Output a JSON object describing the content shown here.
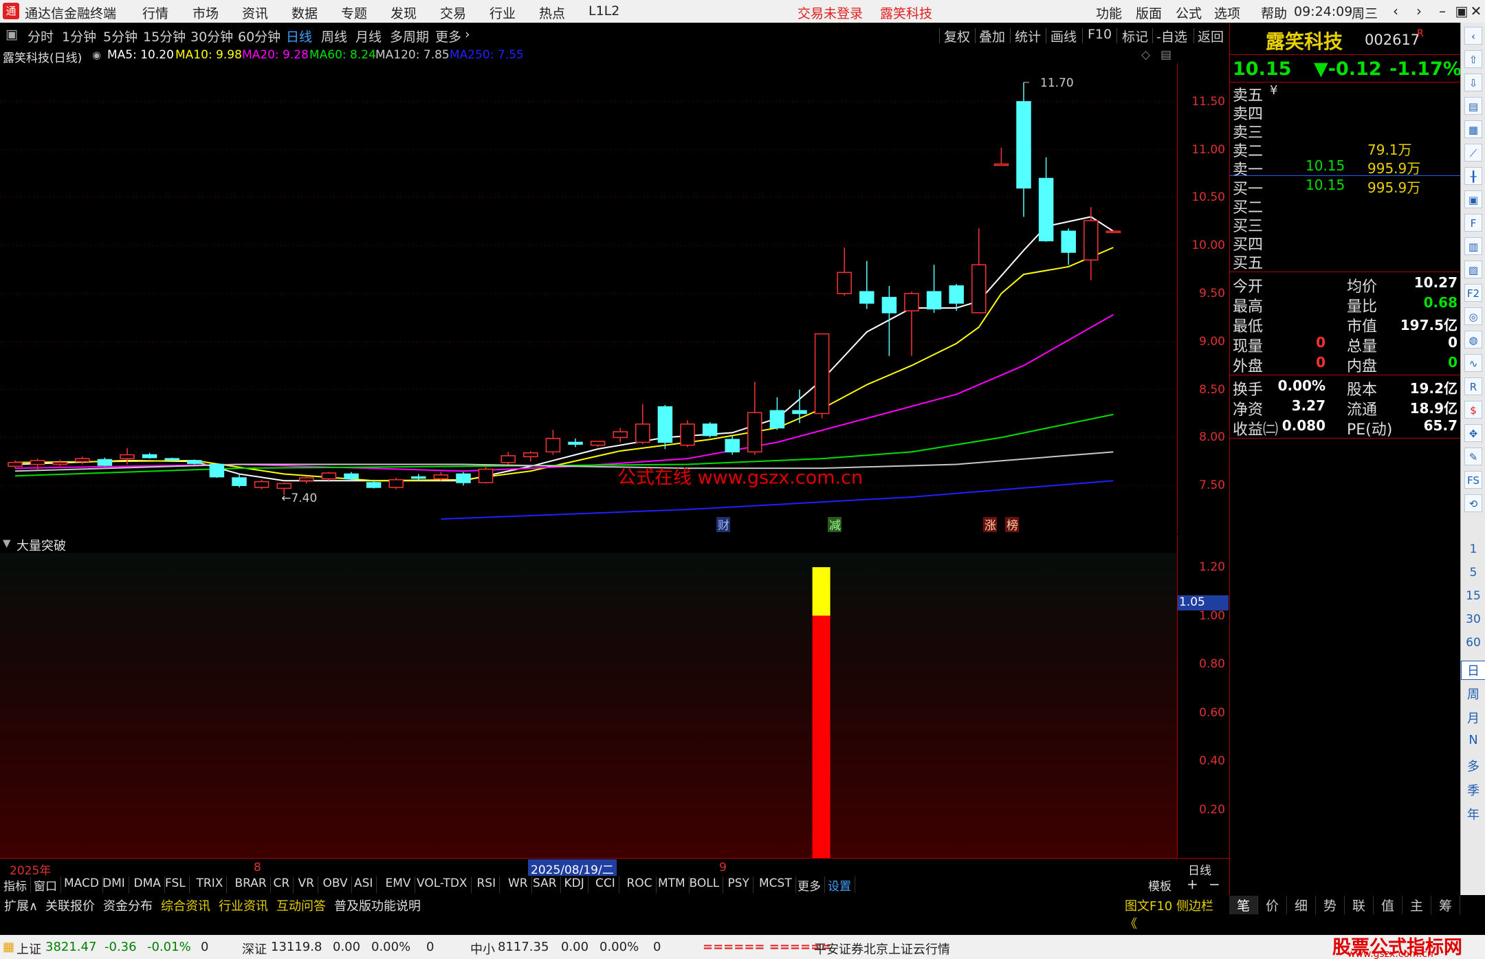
{
  "titlebar": {
    "app_title": "通达信金融终端",
    "menus": [
      "行情",
      "市场",
      "资讯",
      "数据",
      "专题",
      "发现",
      "交易",
      "行业",
      "热点",
      "L1L2"
    ],
    "trade_status": "交易未登录",
    "stock_name": "露笑科技",
    "right_menus": [
      "功能",
      "版面",
      "公式",
      "选项",
      "帮助"
    ],
    "time": "09:24:09",
    "weekday": "周三"
  },
  "periodbar": {
    "periods": [
      "分时",
      "1分钟",
      "5分钟",
      "15分钟",
      "30分钟",
      "60分钟",
      "日线",
      "周线",
      "月线",
      "多周期",
      "更多"
    ],
    "active": "日线",
    "tools": [
      "复权",
      "叠加",
      "统计",
      "画线",
      "F10",
      "标记",
      "-自选",
      "返回"
    ]
  },
  "legend": {
    "title": "露笑科技(日线)",
    "ma": [
      {
        "label": "MA5: 10.20",
        "color": "#ffffff"
      },
      {
        "label": "MA10: 9.98",
        "color": "#ffff00"
      },
      {
        "label": "MA20: 9.28",
        "color": "#ff00ff"
      },
      {
        "label": "MA60: 8.24",
        "color": "#00e000"
      },
      {
        "label": "MA120: 7.85",
        "color": "#c8c8c8"
      },
      {
        "label": "MA250: 7.55",
        "color": "#2020ff"
      }
    ]
  },
  "chart_data": {
    "type": "candlestick",
    "ylim": [
      7.0,
      11.9
    ],
    "y_ticks": [
      "11.50",
      "11.00",
      "10.50",
      "10.00",
      "9.50",
      "9.00",
      "8.50",
      "8.00",
      "7.50"
    ],
    "annotations": {
      "high": "11.70",
      "low": "7.40",
      "watermark": "公式在线  www.gszx.com.cn",
      "events": [
        "财",
        "减",
        "涨",
        "榜"
      ]
    },
    "candles": [
      {
        "o": 7.7,
        "h": 7.76,
        "l": 7.68,
        "c": 7.74
      },
      {
        "o": 7.72,
        "h": 7.78,
        "l": 7.66,
        "c": 7.76
      },
      {
        "o": 7.72,
        "h": 7.77,
        "l": 7.7,
        "c": 7.74
      },
      {
        "o": 7.75,
        "h": 7.8,
        "l": 7.72,
        "c": 7.78
      },
      {
        "o": 7.77,
        "h": 7.79,
        "l": 7.7,
        "c": 7.71
      },
      {
        "o": 7.78,
        "h": 7.89,
        "l": 7.72,
        "c": 7.82
      },
      {
        "o": 7.82,
        "h": 7.84,
        "l": 7.78,
        "c": 7.79
      },
      {
        "o": 7.78,
        "h": 7.79,
        "l": 7.76,
        "c": 7.77
      },
      {
        "o": 7.76,
        "h": 7.77,
        "l": 7.72,
        "c": 7.73
      },
      {
        "o": 7.72,
        "h": 7.73,
        "l": 7.58,
        "c": 7.59
      },
      {
        "o": 7.58,
        "h": 7.62,
        "l": 7.48,
        "c": 7.5
      },
      {
        "o": 7.48,
        "h": 7.56,
        "l": 7.46,
        "c": 7.54
      },
      {
        "o": 7.47,
        "h": 7.53,
        "l": 7.4,
        "c": 7.52
      },
      {
        "o": 7.55,
        "h": 7.6,
        "l": 7.52,
        "c": 7.58
      },
      {
        "o": 7.57,
        "h": 7.64,
        "l": 7.55,
        "c": 7.63
      },
      {
        "o": 7.62,
        "h": 7.64,
        "l": 7.55,
        "c": 7.57
      },
      {
        "o": 7.53,
        "h": 7.56,
        "l": 7.47,
        "c": 7.48
      },
      {
        "o": 7.48,
        "h": 7.58,
        "l": 7.46,
        "c": 7.56
      },
      {
        "o": 7.59,
        "h": 7.62,
        "l": 7.55,
        "c": 7.58
      },
      {
        "o": 7.57,
        "h": 7.64,
        "l": 7.55,
        "c": 7.61
      },
      {
        "o": 7.62,
        "h": 7.64,
        "l": 7.5,
        "c": 7.53
      },
      {
        "o": 7.53,
        "h": 7.7,
        "l": 7.52,
        "c": 7.67
      },
      {
        "o": 7.74,
        "h": 7.85,
        "l": 7.72,
        "c": 7.81
      },
      {
        "o": 7.8,
        "h": 7.86,
        "l": 7.75,
        "c": 7.84
      },
      {
        "o": 7.85,
        "h": 8.08,
        "l": 7.82,
        "c": 7.99
      },
      {
        "o": 7.95,
        "h": 7.99,
        "l": 7.9,
        "c": 7.93
      },
      {
        "o": 7.92,
        "h": 7.96,
        "l": 7.9,
        "c": 7.96
      },
      {
        "o": 8.0,
        "h": 8.1,
        "l": 7.95,
        "c": 8.06
      },
      {
        "o": 7.95,
        "h": 8.35,
        "l": 7.93,
        "c": 8.14
      },
      {
        "o": 8.32,
        "h": 8.34,
        "l": 7.88,
        "c": 7.95
      },
      {
        "o": 7.92,
        "h": 8.18,
        "l": 7.9,
        "c": 8.14
      },
      {
        "o": 8.14,
        "h": 8.16,
        "l": 8.0,
        "c": 8.02
      },
      {
        "o": 7.98,
        "h": 8.02,
        "l": 7.82,
        "c": 7.85
      },
      {
        "o": 7.85,
        "h": 8.58,
        "l": 7.82,
        "c": 8.26
      },
      {
        "o": 8.28,
        "h": 8.42,
        "l": 8.08,
        "c": 8.1
      },
      {
        "o": 8.28,
        "h": 8.5,
        "l": 8.15,
        "c": 8.25
      },
      {
        "o": 8.25,
        "h": 9.08,
        "l": 8.2,
        "c": 9.08
      },
      {
        "o": 9.5,
        "h": 9.98,
        "l": 9.48,
        "c": 9.72
      },
      {
        "o": 9.52,
        "h": 9.84,
        "l": 9.34,
        "c": 9.4
      },
      {
        "o": 9.46,
        "h": 9.58,
        "l": 8.85,
        "c": 9.3
      },
      {
        "o": 9.32,
        "h": 9.52,
        "l": 8.85,
        "c": 9.5
      },
      {
        "o": 9.52,
        "h": 9.8,
        "l": 9.3,
        "c": 9.34
      },
      {
        "o": 9.58,
        "h": 9.6,
        "l": 9.32,
        "c": 9.4
      },
      {
        "o": 9.3,
        "h": 10.18,
        "l": 9.3,
        "c": 9.8
      },
      {
        "o": 10.85,
        "h": 11.02,
        "l": 10.84,
        "c": 10.85
      },
      {
        "o": 11.5,
        "h": 11.7,
        "l": 10.3,
        "c": 10.6
      },
      {
        "o": 10.7,
        "h": 10.92,
        "l": 10.04,
        "c": 10.05
      },
      {
        "o": 10.15,
        "h": 10.18,
        "l": 9.8,
        "c": 9.93
      },
      {
        "o": 9.85,
        "h": 10.4,
        "l": 9.64,
        "c": 10.26
      },
      {
        "o": 10.15,
        "h": 10.16,
        "l": 10.15,
        "c": 10.15
      }
    ],
    "ma_series": [
      {
        "name": "MA5",
        "color": "#ffffff",
        "points": [
          [
            0,
            7.72
          ],
          [
            5,
            7.76
          ],
          [
            8,
            7.75
          ],
          [
            10,
            7.62
          ],
          [
            12,
            7.55
          ],
          [
            16,
            7.55
          ],
          [
            20,
            7.55
          ],
          [
            23,
            7.7
          ],
          [
            26,
            7.88
          ],
          [
            29,
            8.0
          ],
          [
            32,
            8.05
          ],
          [
            34,
            8.2
          ],
          [
            36,
            8.6
          ],
          [
            38,
            9.1
          ],
          [
            40,
            9.35
          ],
          [
            42,
            9.35
          ],
          [
            43,
            9.42
          ],
          [
            45,
            9.95
          ],
          [
            46,
            10.2
          ],
          [
            48,
            10.3
          ],
          [
            49,
            10.15
          ]
        ]
      },
      {
        "name": "MA10",
        "color": "#ffff00",
        "points": [
          [
            0,
            7.74
          ],
          [
            8,
            7.76
          ],
          [
            12,
            7.62
          ],
          [
            16,
            7.55
          ],
          [
            20,
            7.56
          ],
          [
            23,
            7.65
          ],
          [
            27,
            7.86
          ],
          [
            31,
            7.98
          ],
          [
            34,
            8.1
          ],
          [
            36,
            8.3
          ],
          [
            38,
            8.55
          ],
          [
            40,
            8.75
          ],
          [
            42,
            8.98
          ],
          [
            43,
            9.15
          ],
          [
            44,
            9.5
          ],
          [
            45,
            9.7
          ],
          [
            47,
            9.78
          ],
          [
            49,
            9.98
          ]
        ]
      },
      {
        "name": "MA20",
        "color": "#ff00ff",
        "points": [
          [
            0,
            7.68
          ],
          [
            10,
            7.72
          ],
          [
            20,
            7.65
          ],
          [
            25,
            7.7
          ],
          [
            30,
            7.78
          ],
          [
            34,
            7.95
          ],
          [
            38,
            8.2
          ],
          [
            42,
            8.45
          ],
          [
            45,
            8.75
          ],
          [
            49,
            9.28
          ]
        ]
      },
      {
        "name": "MA60",
        "color": "#00e000",
        "points": [
          [
            0,
            7.6
          ],
          [
            10,
            7.68
          ],
          [
            20,
            7.7
          ],
          [
            30,
            7.72
          ],
          [
            36,
            7.78
          ],
          [
            40,
            7.85
          ],
          [
            44,
            8.0
          ],
          [
            49,
            8.24
          ]
        ]
      },
      {
        "name": "MA120",
        "color": "#c8c8c8",
        "points": [
          [
            0,
            7.65
          ],
          [
            10,
            7.72
          ],
          [
            20,
            7.72
          ],
          [
            30,
            7.68
          ],
          [
            36,
            7.68
          ],
          [
            42,
            7.72
          ],
          [
            49,
            7.85
          ]
        ]
      },
      {
        "name": "MA250",
        "color": "#2020ff",
        "points": [
          [
            19,
            7.15
          ],
          [
            30,
            7.25
          ],
          [
            40,
            7.38
          ],
          [
            49,
            7.55
          ]
        ]
      }
    ],
    "sub_indicator": {
      "name": "大量突破",
      "ylim": [
        0,
        1.22
      ],
      "y_ticks": [
        "1.20",
        "1.00",
        "0.80",
        "0.60",
        "0.40",
        "0.20"
      ],
      "bars": [
        {
          "index": 36,
          "value": 1.0,
          "color": "#ff0000"
        },
        {
          "index": 36,
          "from": 1.0,
          "value": 1.2,
          "color": "#ffff00"
        }
      ],
      "cursor_value": "1.05"
    }
  },
  "date_axis": {
    "labels": [
      "2025年",
      "8",
      "2025/08/19/二",
      "9"
    ],
    "period": "日线"
  },
  "indicators": [
    "指标",
    "窗口",
    "MACD",
    "DMI",
    "DMA",
    "FSL",
    "TRIX",
    "BRAR",
    "CR",
    "VR",
    "OBV",
    "ASI",
    "EMV",
    "VOL-TDX",
    "RSI",
    "WR",
    "SAR",
    "KDJ",
    "CCI",
    "ROC",
    "MTM",
    "BOLL",
    "PSY",
    "MCST",
    "更多",
    "设置"
  ],
  "indicator_right": [
    "模板",
    "+",
    "−"
  ],
  "extbar": {
    "items": [
      "扩展∧",
      "关联报价",
      "资金分布",
      "综合资讯",
      "行业资讯",
      "互动问答",
      "普及版功能说明"
    ],
    "right": "图文F10  侧边栏 《"
  },
  "right_tabs": [
    "笔",
    "价",
    "细",
    "势",
    "联",
    "值",
    "主",
    "筹"
  ],
  "quote": {
    "name": "露笑科技",
    "code": "002617",
    "flag": "R",
    "price": "10.15",
    "change": "▼-0.12",
    "pct": "-1.17%",
    "sell": [
      {
        "label": "卖五",
        "price": "",
        "vol": "",
        "yen": "¥"
      },
      {
        "label": "卖四",
        "price": "",
        "vol": ""
      },
      {
        "label": "卖三",
        "price": "",
        "vol": ""
      },
      {
        "label": "卖二",
        "price": "",
        "vol": "79.1万"
      },
      {
        "label": "卖一",
        "price": "10.15",
        "vol": "995.9万"
      }
    ],
    "buy": [
      {
        "label": "买一",
        "price": "10.15",
        "vol": "995.9万"
      },
      {
        "label": "买二",
        "price": "",
        "vol": ""
      },
      {
        "label": "买三",
        "price": "",
        "vol": ""
      },
      {
        "label": "买四",
        "price": "",
        "vol": ""
      },
      {
        "label": "买五",
        "price": "",
        "vol": ""
      }
    ],
    "stats1": [
      {
        "l1": "今开",
        "v1": "",
        "l2": "均价",
        "v2": "10.27",
        "c2": "#ffffff"
      },
      {
        "l1": "最高",
        "v1": "",
        "l2": "量比",
        "v2": "0.68",
        "c2": "#00e000"
      },
      {
        "l1": "最低",
        "v1": "",
        "l2": "市值",
        "v2": "197.5亿",
        "c2": "#ffffff"
      },
      {
        "l1": "现量",
        "v1": "0",
        "l2": "总量",
        "v2": "0",
        "c1": "#ff3030",
        "c2": "#ffffff"
      },
      {
        "l1": "外盘",
        "v1": "0",
        "l2": "内盘",
        "v2": "0",
        "c1": "#ff3030",
        "c2": "#00e000"
      }
    ],
    "stats2": [
      {
        "l1": "换手",
        "v1": "0.00%",
        "l2": "股本",
        "v2": "19.2亿"
      },
      {
        "l1": "净资",
        "v1": "3.27",
        "l2": "流通",
        "v2": "18.9亿"
      },
      {
        "l1": "收益㈡",
        "v1": "0.080",
        "l2": "PE(动)",
        "v2": "65.7"
      }
    ]
  },
  "sidebar_numbers": [
    "1",
    "5",
    "15",
    "30",
    "60"
  ],
  "sidebar_periods": [
    "日",
    "周",
    "月",
    "N",
    "多",
    "季",
    "年"
  ],
  "status": {
    "idx1_name": "上证",
    "idx1_val": "3821.47",
    "idx1_chg": "-0.36",
    "idx1_pct": "-0.01%",
    "idx1_vol": "0",
    "idx2_name": "深证",
    "idx2_val": "13119.8",
    "idx2_chg": "0.00",
    "idx2_pct": "0.00%",
    "idx2_vol": "0",
    "idx3_name": "中小",
    "idx3_val": "8117.35",
    "idx3_chg": "0.00",
    "idx3_pct": "0.00%",
    "idx3_vol": "0",
    "ticker": "====== ======",
    "server": "平安证券北京上证云行情",
    "brand": "股票公式指标网",
    "brand_url": "www.gszx.com.cn"
  }
}
